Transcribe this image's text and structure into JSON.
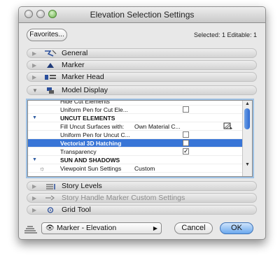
{
  "window": {
    "title": "Elevation Selection Settings"
  },
  "toolbar": {
    "favorites_label": "Favorites...",
    "selection_info": "Selected: 1 Editable: 1"
  },
  "sections_top": [
    {
      "label": "General",
      "icon": "general-icon"
    },
    {
      "label": "Marker",
      "icon": "marker-icon"
    },
    {
      "label": "Marker Head",
      "icon": "marker-head-icon"
    },
    {
      "label": "Model Display",
      "icon": "model-display-icon",
      "expanded": true
    }
  ],
  "model_display_rows": [
    {
      "label": "Hide Cut Elements",
      "value": ""
    },
    {
      "label": "Uniform Pen for Cut Ele...",
      "value": ""
    },
    {
      "label": "UNCUT ELEMENTS",
      "value": ""
    },
    {
      "label": "Fill Uncut Surfaces with:",
      "value": "Own Material C..."
    },
    {
      "label": "Uniform Pen for Uncut C...",
      "value": ""
    },
    {
      "label": "Vectorial 3D Hatching",
      "value": ""
    },
    {
      "label": "Transparency",
      "value": ""
    },
    {
      "label": "SUN AND SHADOWS",
      "value": ""
    },
    {
      "label": "Viewpoint Sun Settings",
      "value": "Custom"
    }
  ],
  "sections_bottom": [
    {
      "label": "Story Levels",
      "icon": "story-levels-icon"
    },
    {
      "label": "Story Handle Marker Custom Settings",
      "icon": "story-handle-icon",
      "dimmed": true
    },
    {
      "label": "Grid Tool",
      "icon": "grid-tool-icon"
    }
  ],
  "footer": {
    "popup_value": "Marker - Elevation",
    "cancel_label": "Cancel",
    "ok_label": "OK"
  },
  "colors": {
    "selection": "#3875d7",
    "ok_button": "#6aa8ee",
    "focus_ring": "#9ec1e4"
  }
}
